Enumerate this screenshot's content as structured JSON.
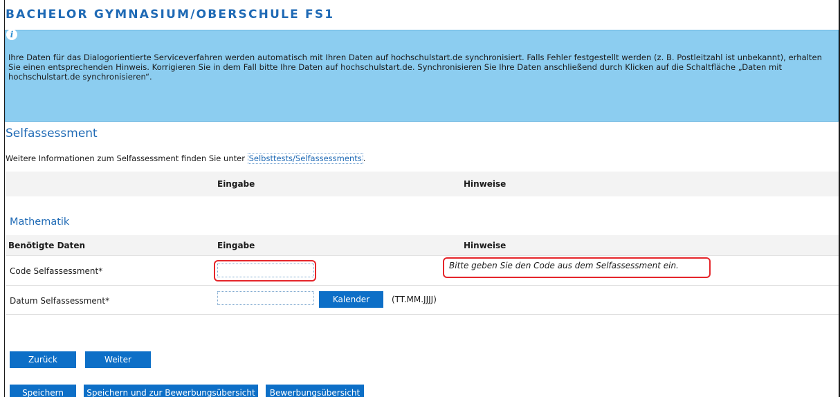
{
  "page": {
    "title": "BACHELOR GYMNASIUM/OBERSCHULE FS1"
  },
  "info": {
    "icon": "info-icon",
    "text": "Ihre Daten für das Dialogorientierte Serviceverfahren werden automatisch mit Ihren Daten auf hochschulstart.de synchronisiert. Falls Fehler festgestellt werden (z. B. Postleitzahl ist unbekannt), erhalten Sie einen entsprechenden Hinweis. Korrigieren Sie in dem Fall bitte Ihre Daten auf hochschulstart.de. Synchronisieren Sie Ihre Daten anschließend durch Klicken auf die Schaltfläche „Daten mit hochschulstart.de synchronisieren“."
  },
  "selfassessment": {
    "title": "Selfassessment",
    "intro_text": "Weitere Informationen zum Selfassessment finden Sie unter ",
    "intro_link": "Selbsttests/Selfassessments",
    "intro_end": ".",
    "header": {
      "input_col": "Eingabe",
      "hint_col": "Hinweise"
    }
  },
  "mathematik": {
    "title": "Mathematik",
    "columns": {
      "data": "Benötigte Daten",
      "input": "Eingabe",
      "hint": "Hinweise"
    },
    "rows": [
      {
        "label": "Code Selfassessment*",
        "value": "",
        "hint": "Bitte geben Sie den Code aus dem Selfassessment ein."
      },
      {
        "label": "Datum Selfassessment*",
        "value": "",
        "button": "Kalender",
        "format": "(TT.MM.JJJJ)"
      }
    ]
  },
  "nav": {
    "back": "Zurück",
    "next": "Weiter"
  },
  "actions": {
    "save": "Speichern",
    "save_overview": "Speichern und zur Bewerbungsübersicht",
    "overview": "Bewerbungsübersicht"
  },
  "colors": {
    "accent": "#1f6ab5",
    "button": "#0d6fc7",
    "info_bg": "#8ccdf0",
    "highlight": "#e5252a"
  }
}
